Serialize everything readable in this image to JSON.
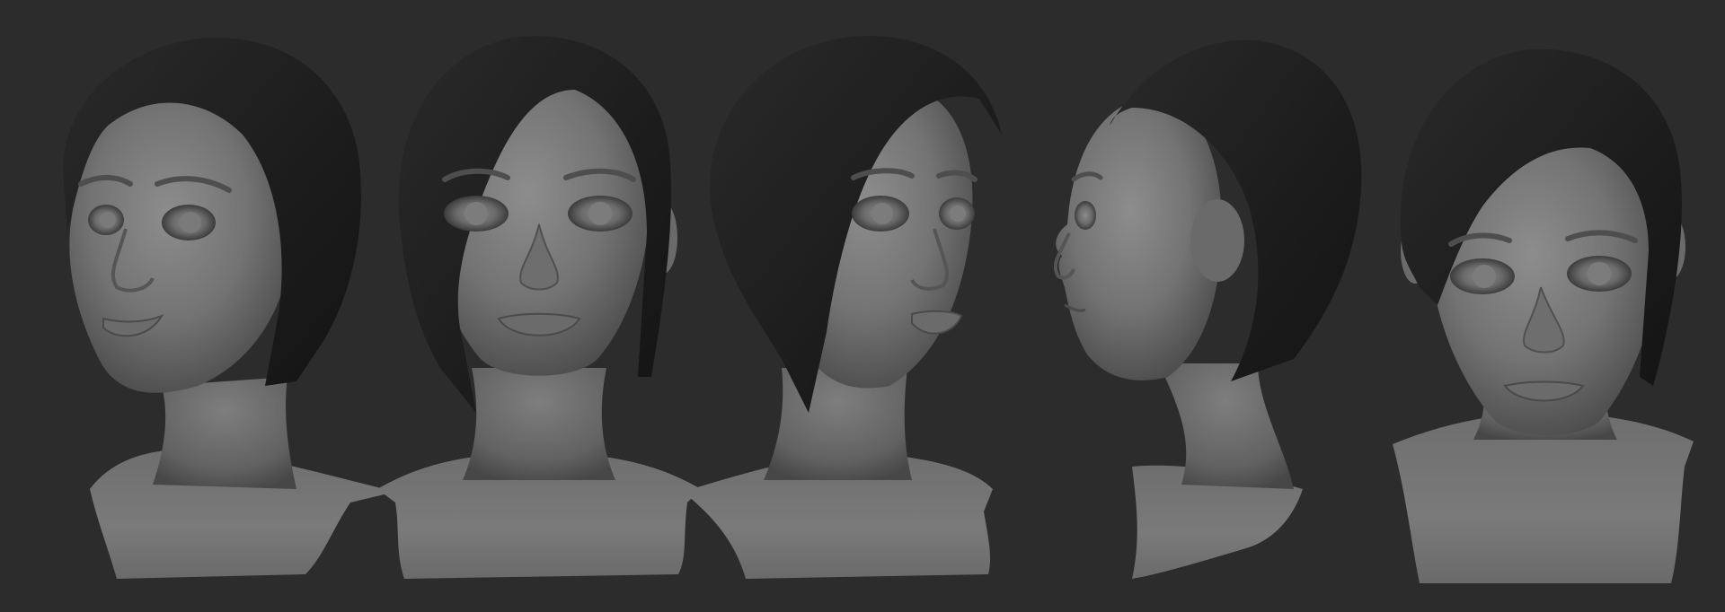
{
  "scene": {
    "description_visible_text": "",
    "background_color": "#2c2c2c",
    "skin_color": "#7a7a7a",
    "hair_color": "#1e1e1e",
    "views": [
      {
        "name": "three-quarter-left-view"
      },
      {
        "name": "front-view"
      },
      {
        "name": "three-quarter-right-view"
      },
      {
        "name": "profile-left-view"
      },
      {
        "name": "front-tilted-view"
      }
    ]
  }
}
